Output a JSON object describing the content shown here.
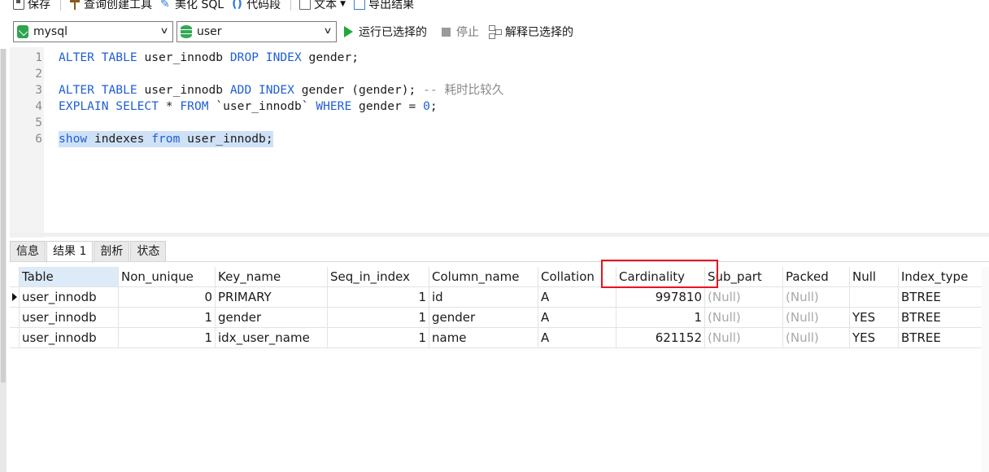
{
  "toolbar": {
    "save": "保存",
    "query_builder": "查询创建工具",
    "beautify_sql": "美化 SQL",
    "code_snippet": "代码段",
    "text": "文本",
    "export_results": "导出结果"
  },
  "selectors": {
    "connection": "mysql",
    "database": "user",
    "run_selected": "运行已选择的",
    "stop": "停止",
    "explain_selected": "解释已选择的"
  },
  "editor": {
    "lines": [
      {
        "n": "1",
        "parts": [
          [
            "kw",
            "ALTER TABLE "
          ],
          [
            "t",
            "user_innodb "
          ],
          [
            "kw",
            "DROP INDEX "
          ],
          [
            "t",
            "gender;"
          ]
        ]
      },
      {
        "n": "2",
        "parts": []
      },
      {
        "n": "3",
        "parts": [
          [
            "kw",
            "ALTER TABLE "
          ],
          [
            "t",
            "user_innodb "
          ],
          [
            "kw",
            "ADD INDEX "
          ],
          [
            "t",
            "gender (gender); "
          ],
          [
            "cmt",
            "-- 耗时比较久"
          ]
        ]
      },
      {
        "n": "4",
        "parts": [
          [
            "kw",
            "EXPLAIN SELECT "
          ],
          [
            "t",
            "* "
          ],
          [
            "kw",
            "FROM "
          ],
          [
            "t",
            "`user_innodb` "
          ],
          [
            "kw",
            "WHERE "
          ],
          [
            "t",
            "gender = "
          ],
          [
            "num",
            "0"
          ],
          [
            "t",
            ";"
          ]
        ]
      },
      {
        "n": "5",
        "parts": []
      },
      {
        "n": "6",
        "parts": [
          [
            "kw",
            "show "
          ],
          [
            "t",
            "indexes "
          ],
          [
            "kw",
            "from "
          ],
          [
            "t",
            "user_innodb;"
          ]
        ],
        "selected": true
      }
    ]
  },
  "tabs": [
    "信息",
    "结果 1",
    "剖析",
    "状态"
  ],
  "active_tab": 1,
  "grid": {
    "columns": [
      "Table",
      "Non_unique",
      "Key_name",
      "Seq_in_index",
      "Column_name",
      "Collation",
      "Cardinality",
      "Sub_part",
      "Packed",
      "Null",
      "Index_type"
    ],
    "rows": [
      [
        "user_innodb",
        "0",
        "PRIMARY",
        "1",
        "id",
        "A",
        "997810",
        "(Null)",
        "(Null)",
        "",
        "BTREE"
      ],
      [
        "user_innodb",
        "1",
        "gender",
        "1",
        "gender",
        "A",
        "1",
        "(Null)",
        "(Null)",
        "YES",
        "BTREE"
      ],
      [
        "user_innodb",
        "1",
        "idx_user_name",
        "1",
        "name",
        "A",
        "621152",
        "(Null)",
        "(Null)",
        "YES",
        "BTREE"
      ]
    ],
    "current_row": 0,
    "highlighted_column": "Cardinality"
  },
  "colors": {
    "keyword": "#1f5fd6",
    "comment": "#8a8a8a",
    "selection": "#cfe1f5",
    "highlight_box": "#e8141c",
    "run_icon": "#20a83a"
  }
}
